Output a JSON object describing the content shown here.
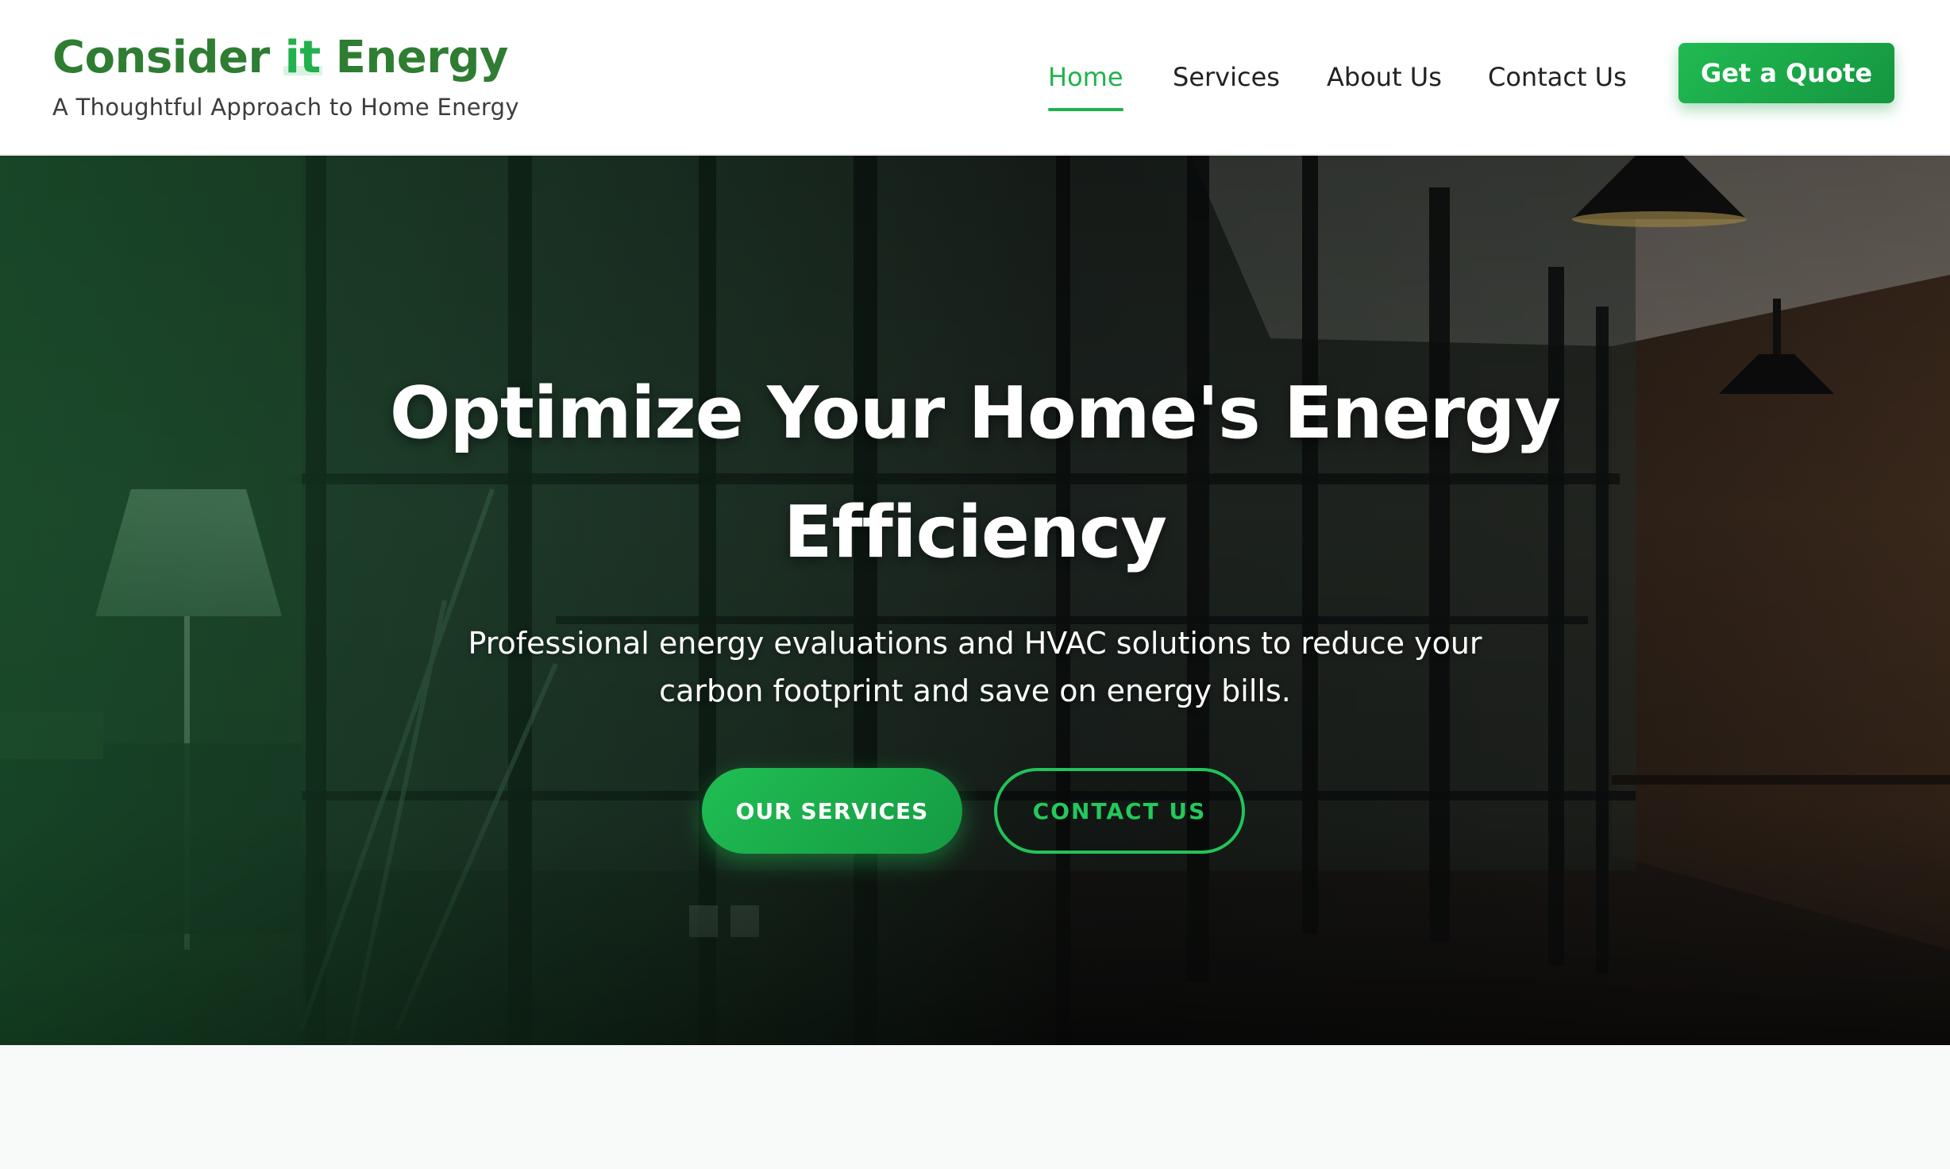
{
  "brand": {
    "name_part1": "Consider ",
    "name_accent": "it",
    "name_part2": " Energy",
    "tagline": "A Thoughtful Approach to Home Energy",
    "primary_color": "#2e7d32",
    "accent_color": "#21b24d"
  },
  "nav": {
    "items": [
      {
        "label": "Home",
        "active": true
      },
      {
        "label": "Services",
        "active": false
      },
      {
        "label": "About Us",
        "active": false
      },
      {
        "label": "Contact Us",
        "active": false
      }
    ],
    "cta_label": "Get a Quote"
  },
  "hero": {
    "title_line1": "Optimize Your Home's Energy",
    "title_line2": "Efficiency",
    "subtitle_line1": "Professional energy evaluations and HVAC solutions to reduce your",
    "subtitle_line2": "carbon footprint and save on energy bills.",
    "primary_button": "OUR SERVICES",
    "secondary_button": "CONTACT US"
  }
}
